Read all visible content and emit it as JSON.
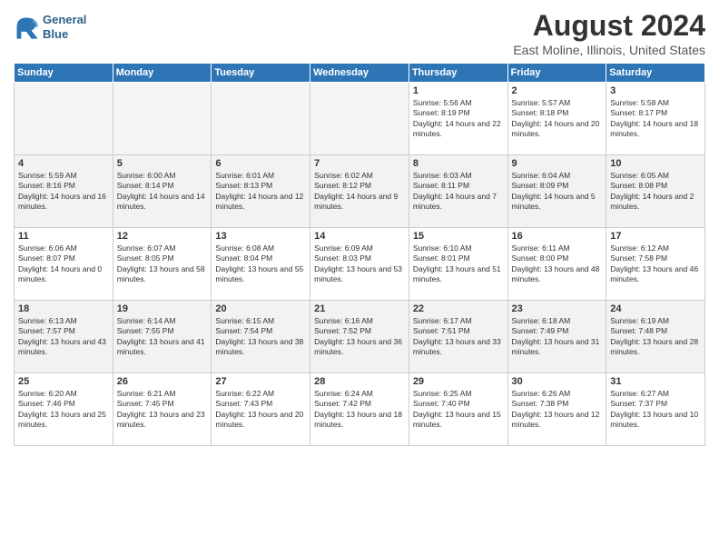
{
  "header": {
    "logo_line1": "General",
    "logo_line2": "Blue",
    "title": "August 2024",
    "subtitle": "East Moline, Illinois, United States"
  },
  "days_of_week": [
    "Sunday",
    "Monday",
    "Tuesday",
    "Wednesday",
    "Thursday",
    "Friday",
    "Saturday"
  ],
  "weeks": [
    [
      {
        "day": "",
        "empty": true
      },
      {
        "day": "",
        "empty": true
      },
      {
        "day": "",
        "empty": true
      },
      {
        "day": "",
        "empty": true
      },
      {
        "day": "1",
        "sunrise": "5:56 AM",
        "sunset": "8:19 PM",
        "daylight": "14 hours and 22 minutes."
      },
      {
        "day": "2",
        "sunrise": "5:57 AM",
        "sunset": "8:18 PM",
        "daylight": "14 hours and 20 minutes."
      },
      {
        "day": "3",
        "sunrise": "5:58 AM",
        "sunset": "8:17 PM",
        "daylight": "14 hours and 18 minutes."
      }
    ],
    [
      {
        "day": "4",
        "sunrise": "5:59 AM",
        "sunset": "8:16 PM",
        "daylight": "14 hours and 16 minutes."
      },
      {
        "day": "5",
        "sunrise": "6:00 AM",
        "sunset": "8:14 PM",
        "daylight": "14 hours and 14 minutes."
      },
      {
        "day": "6",
        "sunrise": "6:01 AM",
        "sunset": "8:13 PM",
        "daylight": "14 hours and 12 minutes."
      },
      {
        "day": "7",
        "sunrise": "6:02 AM",
        "sunset": "8:12 PM",
        "daylight": "14 hours and 9 minutes."
      },
      {
        "day": "8",
        "sunrise": "6:03 AM",
        "sunset": "8:11 PM",
        "daylight": "14 hours and 7 minutes."
      },
      {
        "day": "9",
        "sunrise": "6:04 AM",
        "sunset": "8:09 PM",
        "daylight": "14 hours and 5 minutes."
      },
      {
        "day": "10",
        "sunrise": "6:05 AM",
        "sunset": "8:08 PM",
        "daylight": "14 hours and 2 minutes."
      }
    ],
    [
      {
        "day": "11",
        "sunrise": "6:06 AM",
        "sunset": "8:07 PM",
        "daylight": "14 hours and 0 minutes."
      },
      {
        "day": "12",
        "sunrise": "6:07 AM",
        "sunset": "8:05 PM",
        "daylight": "13 hours and 58 minutes."
      },
      {
        "day": "13",
        "sunrise": "6:08 AM",
        "sunset": "8:04 PM",
        "daylight": "13 hours and 55 minutes."
      },
      {
        "day": "14",
        "sunrise": "6:09 AM",
        "sunset": "8:03 PM",
        "daylight": "13 hours and 53 minutes."
      },
      {
        "day": "15",
        "sunrise": "6:10 AM",
        "sunset": "8:01 PM",
        "daylight": "13 hours and 51 minutes."
      },
      {
        "day": "16",
        "sunrise": "6:11 AM",
        "sunset": "8:00 PM",
        "daylight": "13 hours and 48 minutes."
      },
      {
        "day": "17",
        "sunrise": "6:12 AM",
        "sunset": "7:58 PM",
        "daylight": "13 hours and 46 minutes."
      }
    ],
    [
      {
        "day": "18",
        "sunrise": "6:13 AM",
        "sunset": "7:57 PM",
        "daylight": "13 hours and 43 minutes."
      },
      {
        "day": "19",
        "sunrise": "6:14 AM",
        "sunset": "7:55 PM",
        "daylight": "13 hours and 41 minutes."
      },
      {
        "day": "20",
        "sunrise": "6:15 AM",
        "sunset": "7:54 PM",
        "daylight": "13 hours and 38 minutes."
      },
      {
        "day": "21",
        "sunrise": "6:16 AM",
        "sunset": "7:52 PM",
        "daylight": "13 hours and 36 minutes."
      },
      {
        "day": "22",
        "sunrise": "6:17 AM",
        "sunset": "7:51 PM",
        "daylight": "13 hours and 33 minutes."
      },
      {
        "day": "23",
        "sunrise": "6:18 AM",
        "sunset": "7:49 PM",
        "daylight": "13 hours and 31 minutes."
      },
      {
        "day": "24",
        "sunrise": "6:19 AM",
        "sunset": "7:48 PM",
        "daylight": "13 hours and 28 minutes."
      }
    ],
    [
      {
        "day": "25",
        "sunrise": "6:20 AM",
        "sunset": "7:46 PM",
        "daylight": "13 hours and 25 minutes."
      },
      {
        "day": "26",
        "sunrise": "6:21 AM",
        "sunset": "7:45 PM",
        "daylight": "13 hours and 23 minutes."
      },
      {
        "day": "27",
        "sunrise": "6:22 AM",
        "sunset": "7:43 PM",
        "daylight": "13 hours and 20 minutes."
      },
      {
        "day": "28",
        "sunrise": "6:24 AM",
        "sunset": "7:42 PM",
        "daylight": "13 hours and 18 minutes."
      },
      {
        "day": "29",
        "sunrise": "6:25 AM",
        "sunset": "7:40 PM",
        "daylight": "13 hours and 15 minutes."
      },
      {
        "day": "30",
        "sunrise": "6:26 AM",
        "sunset": "7:38 PM",
        "daylight": "13 hours and 12 minutes."
      },
      {
        "day": "31",
        "sunrise": "6:27 AM",
        "sunset": "7:37 PM",
        "daylight": "13 hours and 10 minutes."
      }
    ]
  ]
}
